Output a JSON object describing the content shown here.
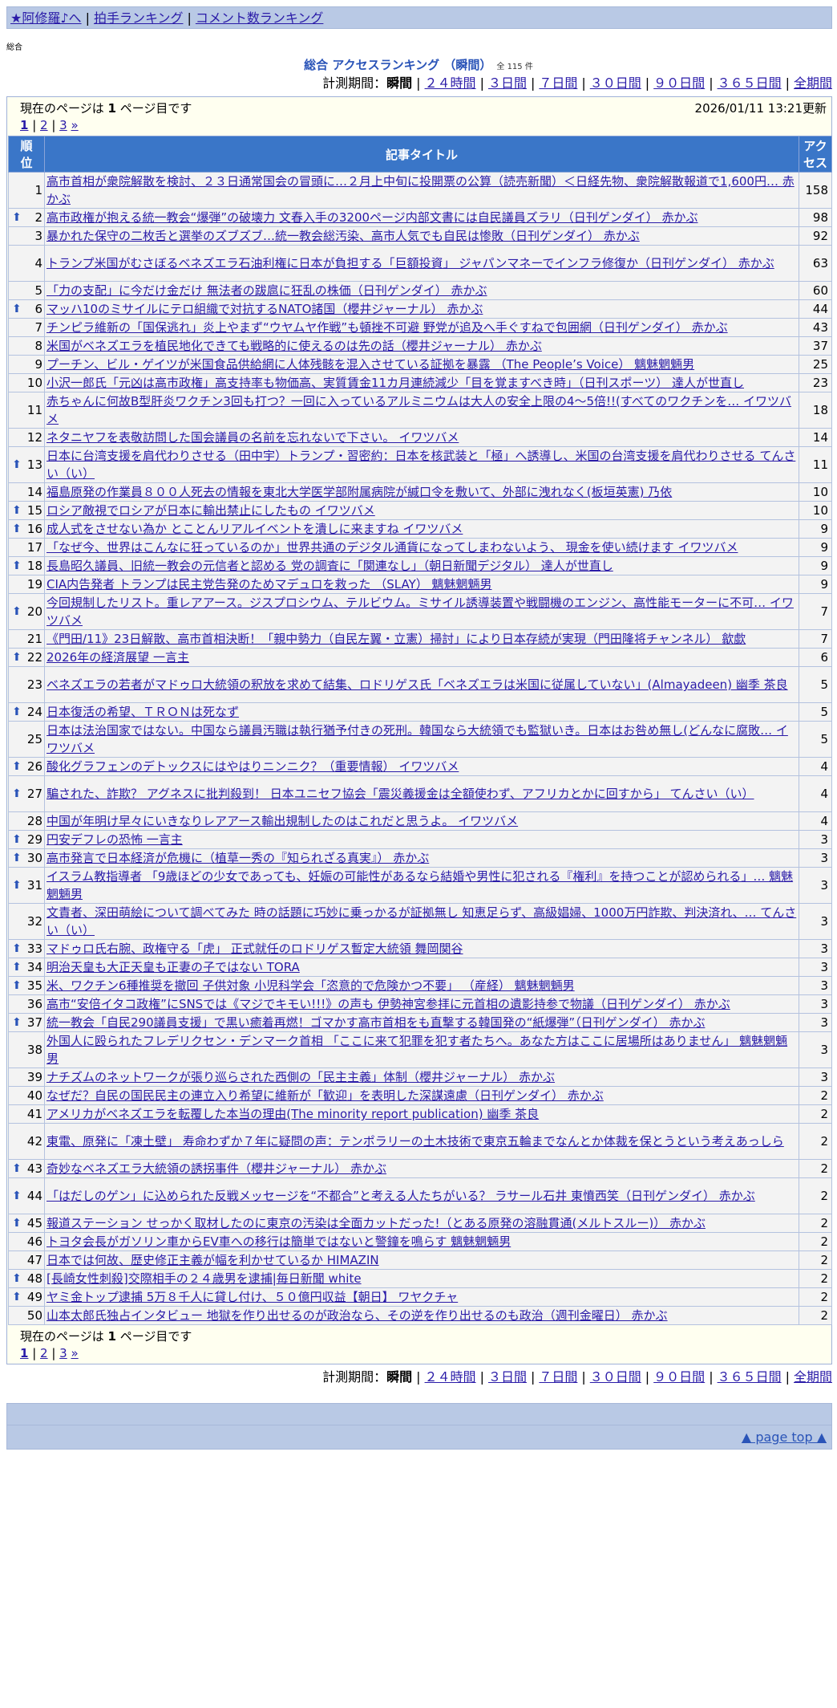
{
  "nav": {
    "home": "★阿修羅♪へ",
    "clap_ranking": "拍手ランキング",
    "comment_ranking": "コメント数ランキング",
    "sep": "|"
  },
  "small_label": "総合",
  "title": "総合 アクセスランキング （瞬間）",
  "count": "全 115 件",
  "period": {
    "label": "計測期間：",
    "current": "瞬間",
    "options": [
      "２４時間",
      "３日間",
      "７日間",
      "３０日間",
      "９０日間",
      "３６５日間",
      "全期間"
    ]
  },
  "pager": {
    "current_text_prefix": "現在のページは ",
    "current_page": "1",
    "current_text_suffix": " ページ目です",
    "updated": "2026/01/11 13:21更新",
    "pages": [
      "1",
      "2",
      "3"
    ],
    "next": "»"
  },
  "table": {
    "headers": {
      "rank": "順位",
      "title": "記事タイトル",
      "access": "アクセス"
    },
    "rows": [
      {
        "rank": "1",
        "up": false,
        "tall": true,
        "title": "高市首相が衆院解散を検討、２３日通常国会の冒頭に…２月上中旬に投開票の公算（読売新聞）＜日経先物、衆院解散報道で1,600円… 赤かぶ",
        "count": "158"
      },
      {
        "rank": "2",
        "up": true,
        "tall": false,
        "title": "高市政権が抱える統一教会“爆弾”の破壊力 文春入手の3200ページ内部文書には自民議員ズラリ（日刊ゲンダイ） 赤かぶ",
        "count": "98"
      },
      {
        "rank": "3",
        "up": false,
        "tall": false,
        "title": "暴かれた保守の二枚舌と選挙のズブズブ…統一教会総汚染、高市人気でも自民は惨敗（日刊ゲンダイ） 赤かぶ",
        "count": "92"
      },
      {
        "rank": "4",
        "up": false,
        "tall": true,
        "title": "トランプ米国がむさぼるベネズエラ石油利権に日本が負担する「巨額投資」 ジャパンマネーでインフラ修復か（日刊ゲンダイ） 赤かぶ",
        "count": "63"
      },
      {
        "rank": "5",
        "up": false,
        "tall": false,
        "title": "「力の支配」に今だけ金だけ 無法者の跋扈に狂乱の株価（日刊ゲンダイ） 赤かぶ",
        "count": "60"
      },
      {
        "rank": "6",
        "up": true,
        "tall": false,
        "title": "マッハ10のミサイルにテロ組織で対抗するNATO諸国（櫻井ジャーナル） 赤かぶ",
        "count": "44"
      },
      {
        "rank": "7",
        "up": false,
        "tall": false,
        "title": "チンピラ維新の「国保逃れ」炎上やまず“ウヤムヤ作戦”も頓挫不可避 野党が追及へ手ぐすねで包囲網（日刊ゲンダイ） 赤かぶ",
        "count": "43"
      },
      {
        "rank": "8",
        "up": false,
        "tall": false,
        "title": "米国がベネズエラを植民地化できても戦略的に使えるのは先の話（櫻井ジャーナル） 赤かぶ",
        "count": "37"
      },
      {
        "rank": "9",
        "up": false,
        "tall": false,
        "title": "プーチン、ビル・ゲイツが米国食品供給網に人体残骸を混入させている証拠を暴露 （The People’s Voice） 魑魅魍魎男",
        "count": "25"
      },
      {
        "rank": "10",
        "up": false,
        "tall": false,
        "title": "小沢一郎氏「元凶は高市政権」高支持率も物価高、実質賃金11カ月連続減少「目を覚ますべき時」（日刊スポーツ） 達人が世直し",
        "count": "23"
      },
      {
        "rank": "11",
        "up": false,
        "tall": true,
        "title": "赤ちゃんに何故B型肝炎ワクチン3回も打つ？一回に入っているアルミニウムは大人の安全上限の4～5倍!!(すべてのワクチンを… イワツバメ",
        "count": "18"
      },
      {
        "rank": "12",
        "up": false,
        "tall": false,
        "title": "ネタニヤフを表敬訪問した国会議員の名前を忘れないで下さい。 イワツバメ",
        "count": "14"
      },
      {
        "rank": "13",
        "up": true,
        "tall": true,
        "title": "日本に台湾支援を肩代わりさせる（田中宇）トランプ・習密約：日本を核武装と「極」へ誘導し、米国の台湾支援を肩代わりさせる てんさい（い）",
        "count": "11"
      },
      {
        "rank": "14",
        "up": false,
        "tall": false,
        "title": "福島原発の作業員８００人死去の情報を東北大学医学部附属病院が緘口令を敷いて、外部に洩れなく(板垣英憲) 乃依",
        "count": "10"
      },
      {
        "rank": "15",
        "up": true,
        "tall": false,
        "title": "ロシア敵視でロシアが日本に輸出禁止にしたもの イワツバメ",
        "count": "10"
      },
      {
        "rank": "16",
        "up": true,
        "tall": false,
        "title": "成人式をさせない為か とことんリアルイベントを潰しに来ますね イワツバメ",
        "count": "9"
      },
      {
        "rank": "17",
        "up": false,
        "tall": false,
        "title": "「なぜ今、世界はこんなに狂っているのか」世界共通のデジタル通貨になってしまわないよう、 現金を使い続けます イワツバメ",
        "count": "9"
      },
      {
        "rank": "18",
        "up": true,
        "tall": false,
        "title": "長島昭久議員、旧統一教会の元信者と認める 党の調査に「関連なし」（朝日新聞デジタル） 達人が世直し",
        "count": "9"
      },
      {
        "rank": "19",
        "up": false,
        "tall": false,
        "title": "CIA内告発者 トランプは民主党告発のためマデュロを救った （SLAY） 魑魅魍魎男",
        "count": "9"
      },
      {
        "rank": "20",
        "up": true,
        "tall": true,
        "title": "今回規制したリスト。重レアアース。ジスプロシウム、テルビウム。ミサイル誘導装置や戦闘機のエンジン、高性能モーターに不可… イワツバメ",
        "count": "7"
      },
      {
        "rank": "21",
        "up": false,
        "tall": false,
        "title": "《門田/11》23日解散、高市首相決断！「親中勢力（自民左翼・立憲）掃討」により日本存続が実現（門田隆将チャンネル） 歙歔",
        "count": "7"
      },
      {
        "rank": "22",
        "up": true,
        "tall": false,
        "title": "2026年の経済展望 一言主",
        "count": "6"
      },
      {
        "rank": "23",
        "up": false,
        "tall": true,
        "title": "ベネズエラの若者がマドゥロ大統領の釈放を求めて結集、ロドリゲス氏「ベネズエラは米国に従属していない」(Almayadeen) 幽季 茶良",
        "count": "5"
      },
      {
        "rank": "24",
        "up": true,
        "tall": false,
        "title": "日本復活の希望、ＴＲＯＮは死なず",
        "count": "5"
      },
      {
        "rank": "25",
        "up": false,
        "tall": true,
        "title": "日本は法治国家ではない。中国なら議員汚職は執行猶予付きの死刑。韓国なら大統領でも監獄いき。日本はお咎め無し(どんなに腐敗… イワツバメ",
        "count": "5"
      },
      {
        "rank": "26",
        "up": true,
        "tall": false,
        "title": "酸化グラフェンのデトックスにはやはりニンニク？（重要情報） イワツバメ",
        "count": "4"
      },
      {
        "rank": "27",
        "up": true,
        "tall": true,
        "title": "騙された、詐欺？ アグネスに批判殺到！ 日本ユニセフ協会「震災義援金は全額使わず、アフリカとかに回すから」 てんさい（い）",
        "count": "4"
      },
      {
        "rank": "28",
        "up": false,
        "tall": false,
        "title": "中国が年明け早々にいきなりレアアース輸出規制したのはこれだと思うよ。 イワツバメ",
        "count": "4"
      },
      {
        "rank": "29",
        "up": true,
        "tall": false,
        "title": "円安デフレの恐怖 一言主",
        "count": "3"
      },
      {
        "rank": "30",
        "up": true,
        "tall": false,
        "title": "高市発言で日本経済が危機に（植草一秀の『知られざる真実』） 赤かぶ",
        "count": "3"
      },
      {
        "rank": "31",
        "up": true,
        "tall": true,
        "title": "イスラム教指導者 「9歳ほどの少女であっても、妊娠の可能性があるなら結婚や男性に犯される『権利』を持つことが認められる」… 魑魅魍魎男",
        "count": "3"
      },
      {
        "rank": "32",
        "up": false,
        "tall": true,
        "title": "文責者、深田萌絵について調べてみた 時の話題に巧妙に乗っかるが証拠無し 知恵足らず、高級娼婦、1000万円詐欺、判決済れ、… てんさい（い）",
        "count": "3"
      },
      {
        "rank": "33",
        "up": true,
        "tall": false,
        "title": "マドゥロ氏右腕、政権守る「虎」 正式就任のロドリゲス暫定大統領 舞岡関谷",
        "count": "3"
      },
      {
        "rank": "34",
        "up": true,
        "tall": false,
        "title": "明治天皇も大正天皇も正妻の子ではない TORA",
        "count": "3"
      },
      {
        "rank": "35",
        "up": true,
        "tall": false,
        "title": "米、ワクチン6種推奨を撤回 子供対象 小児科学会「恣意的で危険かつ不要」 （産経） 魑魅魍魎男",
        "count": "3"
      },
      {
        "rank": "36",
        "up": false,
        "tall": false,
        "title": "高市“安倍イタコ政権”にSNSでは《マジでキモい!!!》の声も 伊勢神宮参拝に元首相の遺影持参で物議（日刊ゲンダイ） 赤かぶ",
        "count": "3"
      },
      {
        "rank": "37",
        "up": true,
        "tall": false,
        "title": "統一教会「自民290議員支援」で黒い癒着再燃！ゴマかす高市首相をも直撃する韓国発の“紙爆弾”（日刊ゲンダイ） 赤かぶ",
        "count": "3"
      },
      {
        "rank": "38",
        "up": false,
        "tall": true,
        "title": "外国人に殴られたフレデリクセン・デンマーク首相 「ここに来て犯罪を犯す者たちへ。あなた方はここに居場所はありません」 魑魅魍魎男",
        "count": "3"
      },
      {
        "rank": "39",
        "up": false,
        "tall": false,
        "title": "ナチズムのネットワークが張り巡らされた西側の「民主主義」体制（櫻井ジャーナル） 赤かぶ",
        "count": "3"
      },
      {
        "rank": "40",
        "up": false,
        "tall": false,
        "title": "なぜだ？自民の国民民主の連立入り希望に維新が「歓迎」を表明した深謀遠慮（日刊ゲンダイ） 赤かぶ",
        "count": "2"
      },
      {
        "rank": "41",
        "up": false,
        "tall": false,
        "title": "アメリカがベネズエラを転覆した本当の理由(The minority report publication) 幽季 茶良",
        "count": "2"
      },
      {
        "rank": "42",
        "up": false,
        "tall": true,
        "title": "東電、原発に「凍土壁」 寿命わずか７年に疑問の声：テンポラリーの土木技術で東京五輪までなんとか体裁を保とうという考えあっしら",
        "count": "2"
      },
      {
        "rank": "43",
        "up": true,
        "tall": false,
        "title": "奇妙なベネズエラ大統領の誘拐事件（櫻井ジャーナル） 赤かぶ",
        "count": "2"
      },
      {
        "rank": "44",
        "up": true,
        "tall": true,
        "title": "「はだしのゲン」に込められた反戦メッセージを“不都合”と考える人たちがいる？ ラサール石井 東憤西笑（日刊ゲンダイ） 赤かぶ",
        "count": "2"
      },
      {
        "rank": "45",
        "up": true,
        "tall": false,
        "title": "報道ステーション せっかく取材したのに東京の汚染は全面カットだった!（とある原発の溶融貫通(メルトスルー)） 赤かぶ",
        "count": "2"
      },
      {
        "rank": "46",
        "up": false,
        "tall": false,
        "title": "トヨタ会長がガソリン車からEV車への移行は簡単ではないと警鐘を鳴らす 魑魅魍魎男",
        "count": "2"
      },
      {
        "rank": "47",
        "up": false,
        "tall": false,
        "title": "日本では何故、歴史修正主義が幅を利かせているか HIMAZIN",
        "count": "2"
      },
      {
        "rank": "48",
        "up": true,
        "tall": false,
        "title": "[長崎女性刺殺]交際相手の２４歳男を逮捕|毎日新聞 white",
        "count": "2"
      },
      {
        "rank": "49",
        "up": true,
        "tall": false,
        "title": "ヤミ金トップ逮捕 5万８千人に貸し付け、５０億円収益【朝日】 ワヤクチャ",
        "count": "2"
      },
      {
        "rank": "50",
        "up": false,
        "tall": false,
        "title": "山本太郎氏独占インタビュー 地獄を作り出せるのが政治なら、その逆を作り出せるのも政治（週刊金曜日） 赤かぶ",
        "count": "2"
      }
    ]
  },
  "up_arrow": "⬆",
  "page_top": "▲ page top ▲",
  "colors": {
    "link": "#2a1ba8",
    "header_bg": "#3a76c8",
    "nav_bg": "#b9c9e5",
    "panel_bg": "#fffff0"
  }
}
